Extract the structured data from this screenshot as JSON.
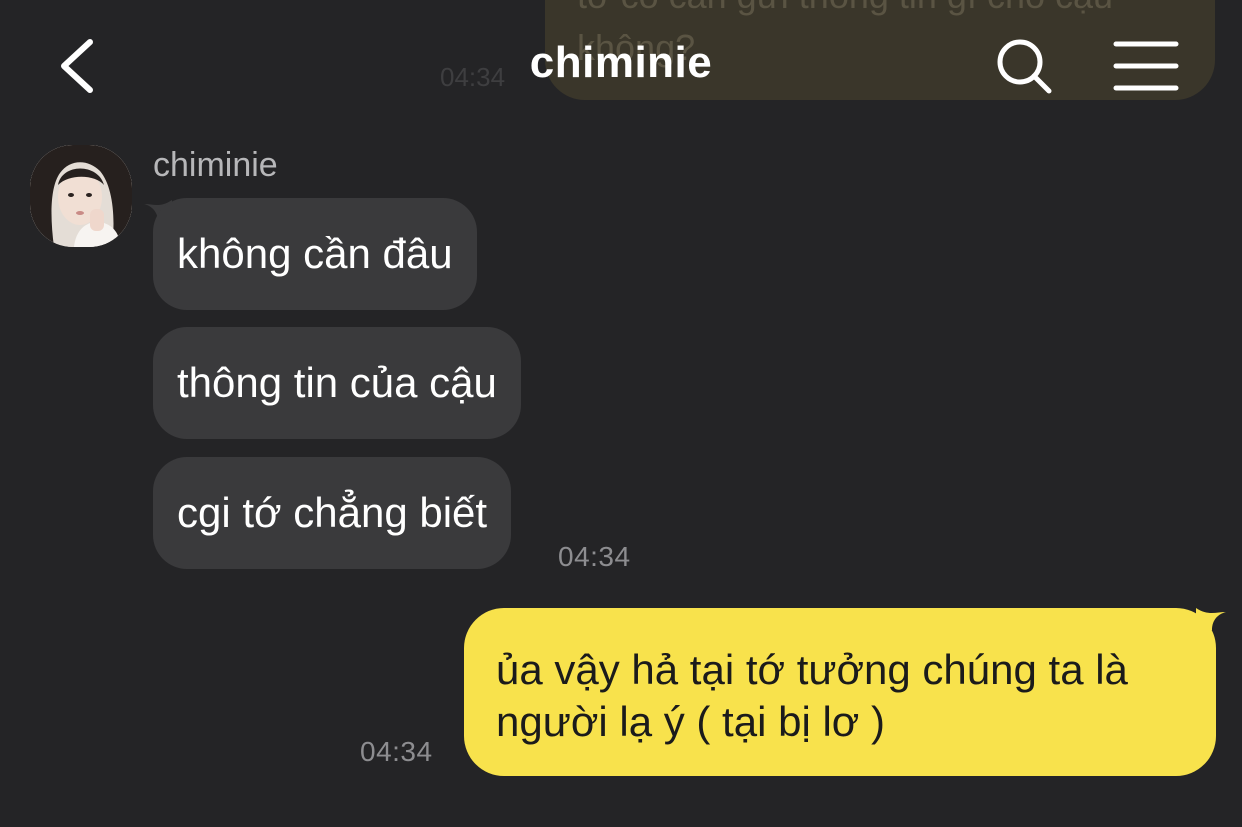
{
  "header": {
    "title": "chiminie",
    "back_icon": "chevron-left-icon",
    "search_icon": "search-icon",
    "menu_icon": "hamburger-menu-icon"
  },
  "previous_message": {
    "text": "tớ có cần gửi thông tin gì cho cậu không?",
    "time": "04:34"
  },
  "incoming": {
    "sender": "chiminie",
    "messages": [
      "không cần đâu",
      "thông tin của cậu",
      "cgi tớ chẳng biết"
    ],
    "time": "04:34"
  },
  "outgoing": {
    "text": "ủa vậy hả tại tớ tưởng chúng ta là người lạ ý ( tại bị lơ )",
    "time": "04:34"
  },
  "colors": {
    "background": "#242426",
    "incoming_bubble": "#3a3a3c",
    "outgoing_bubble": "#f8e24c",
    "timestamp": "#8d8d90"
  }
}
